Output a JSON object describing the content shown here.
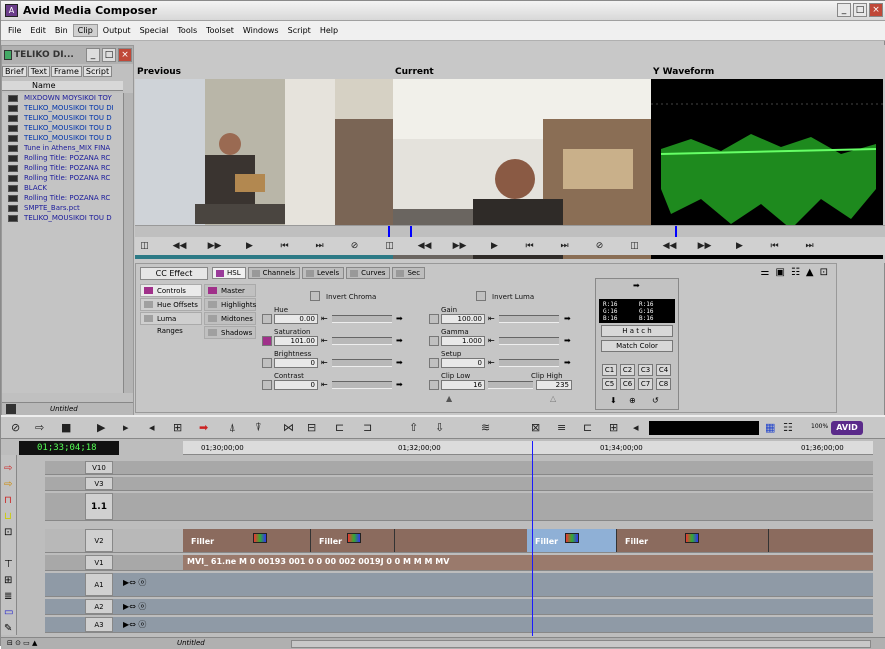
{
  "app": {
    "title": "Avid Media Composer"
  },
  "menubar": [
    "File",
    "Edit",
    "Bin",
    "Clip",
    "Output",
    "Special",
    "Tools",
    "Toolset",
    "Windows",
    "Script",
    "Help"
  ],
  "menubar_active": "Clip",
  "bin": {
    "title": "TELIKO DI...",
    "tabs": [
      "Brief",
      "Text",
      "Frame",
      "Script"
    ],
    "active_tab": "Brief",
    "column_name": "Name",
    "clips": [
      "MIXDOWN MOYSIKOI TOY",
      "TELIKO_MOUSIKOI TOU DI",
      "TELIKO_MOUSIKOI TOU D",
      "TELIKO_MOUSIKOI TOU D",
      "TELIKO_MOUSIKOI TOU D",
      "Tune in Athens_MIX FINA",
      "Rolling Title: POZANA RC",
      "Rolling Title: POZANA RC",
      "Rolling Title: POZANA RC",
      "BLACK",
      "Rolling Title: POZANA RC",
      "SMPTE_Bars.pct",
      "TELIKO_MOUSIKOI TOU D"
    ],
    "footer_label": "Untitled"
  },
  "monitors": {
    "previous": "Previous",
    "current": "Current",
    "waveform": "Y Waveform"
  },
  "cc": {
    "effect_tab": "CC Effect",
    "tabs": [
      "HSL",
      "Channels",
      "Levels",
      "Curves",
      "Sec"
    ],
    "active_tab": "HSL",
    "left_nav": [
      "Controls",
      "Hue Offsets",
      "Luma Ranges"
    ],
    "sub_nav": [
      "Master",
      "Highlights",
      "Midtones",
      "Shadows"
    ],
    "invert_chroma": "Invert Chroma",
    "invert_luma": "Invert Luma",
    "hue": {
      "label": "Hue",
      "value": "0.00"
    },
    "saturation": {
      "label": "Saturation",
      "value": "101.00"
    },
    "brightness": {
      "label": "Brightness",
      "value": "0"
    },
    "contrast": {
      "label": "Contrast",
      "value": "0"
    },
    "gain": {
      "label": "Gain",
      "value": "100.00"
    },
    "gamma": {
      "label": "Gamma",
      "value": "1.000"
    },
    "setup": {
      "label": "Setup",
      "value": "0"
    },
    "clip_low": {
      "label": "Clip Low",
      "value": "16"
    },
    "clip_high": {
      "label": "Clip High",
      "value": "235"
    },
    "readout_left": [
      "R:16",
      "G:16",
      "B:16"
    ],
    "readout_right": [
      "R:16",
      "G:16",
      "B:16"
    ],
    "dropdown": "H a t c h",
    "match_color": "Match Color",
    "buckets": [
      "C1",
      "C2",
      "C3",
      "C4",
      "C5",
      "C6",
      "C7",
      "C8"
    ]
  },
  "timeline": {
    "timecode": "01;33;04;18",
    "ruler_labels": [
      "01;30;00;00",
      "01;32;00;00",
      "01;34;00;00",
      "01;36;00;00"
    ],
    "tracks": [
      "V10",
      "V3",
      "1.1",
      "V2",
      "V1",
      "A1",
      "A2",
      "A3"
    ],
    "v2_labels": [
      "Filler",
      "Filler",
      "Filler",
      "Filler"
    ],
    "v1_text": "MVI_ 61.ne  M  0  00193   001  0  0  00  002  0019J   0  0  M  M  M  MV",
    "footer": "Untitled",
    "zoom_label": "100%"
  },
  "colors": {
    "accent": "#9a3a9a",
    "playhead": "#1a1aff",
    "timecode": "#55ff55",
    "selected_filler": "#8fb0d6"
  }
}
